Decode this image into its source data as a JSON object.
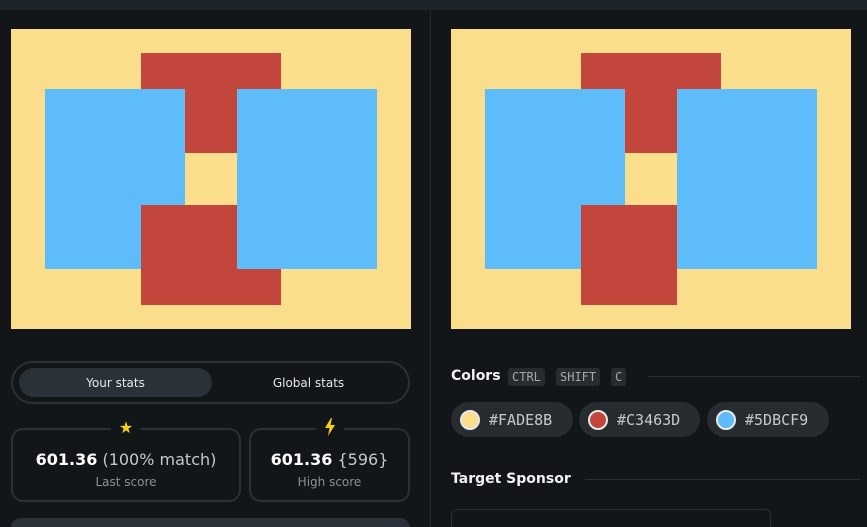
{
  "palette": {
    "background": "#FADE8B",
    "red": "#C3463D",
    "blue": "#5DBCF9"
  },
  "stats_tabs": {
    "active": "Your stats",
    "inactive": "Global stats"
  },
  "last_score": {
    "icon": "star-icon",
    "value": "601.36",
    "detail": "(100% match)",
    "label": "Last score"
  },
  "high_score": {
    "icon": "lightning-icon",
    "value": "601.36",
    "detail": "{596}",
    "label": "High score"
  },
  "colors": {
    "title": "Colors",
    "shortcut": [
      "CTRL",
      "SHIFT",
      "C"
    ],
    "swatches": [
      {
        "hex": "#FADE8B",
        "color": "#FADE8B"
      },
      {
        "hex": "#C3463D",
        "color": "#C3463D"
      },
      {
        "hex": "#5DBCF9",
        "color": "#5DBCF9"
      }
    ]
  },
  "sponsor": {
    "title": "Target Sponsor"
  }
}
